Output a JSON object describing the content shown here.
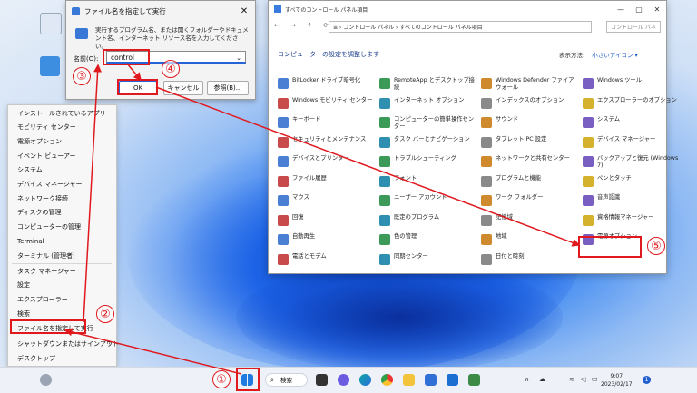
{
  "run_dialog": {
    "title": "ファイル名を指定して実行",
    "close": "✕",
    "description": "実行するプログラム名、または開くフォルダーやドキュメント名、インターネット リソース名を入力してください。",
    "label": "名前(O):",
    "value": "control",
    "ok": "OK",
    "cancel": "キャンセル",
    "browse": "参照(B)..."
  },
  "context_menu": {
    "items": [
      "インストールされているアプリ",
      "モビリティ センター",
      "電源オプション",
      "イベント ビューアー",
      "システム",
      "デバイス マネージャー",
      "ネットワーク接続",
      "ディスクの管理",
      "コンピューターの管理",
      "Terminal",
      "ターミナル (管理者)",
      "タスク マネージャー",
      "設定",
      "エクスプローラー",
      "検索",
      "ファイル名を指定して実行",
      "シャットダウンまたはサインアウト",
      "デスクトップ"
    ],
    "submenu_arrow": "›"
  },
  "control_panel": {
    "title": "すべてのコントロール パネル項目",
    "nav": "← → ↑ ⟳",
    "address": "≡ › コントロール パネル › すべてのコントロール パネル項目",
    "search_placeholder": "コントロール パネ",
    "heading": "コンピューターの設定を調整します",
    "view_label": "表示方法:",
    "view_value": "小さいアイコン ▾",
    "items": [
      [
        "BitLocker ドライブ暗号化",
        "RemoteApp とデスクトップ接続",
        "Windows Defender ファイアウォール",
        "Windows ツール"
      ],
      [
        "Windows モビリティ センター",
        "インターネット オプション",
        "インデックスのオプション",
        "エクスプローラーのオプション"
      ],
      [
        "キーボード",
        "コンピューターの簡単操作センター",
        "サウンド",
        "システム"
      ],
      [
        "セキュリティとメンテナンス",
        "タスク バーとナビゲーション",
        "タブレット PC 設定",
        "デバイス マネージャー"
      ],
      [
        "デバイスとプリンター",
        "トラブルシューティング",
        "ネットワークと共有センター",
        "バックアップと復元 (Windows 7)"
      ],
      [
        "ファイル履歴",
        "フォント",
        "プログラムと機能",
        "ペンとタッチ"
      ],
      [
        "マウス",
        "ユーザー アカウント",
        "ワーク フォルダー",
        "音声認識"
      ],
      [
        "回復",
        "既定のプログラム",
        "記憶域",
        "資格情報マネージャー"
      ],
      [
        "自動再生",
        "色の管理",
        "地域",
        "電源オプション"
      ],
      [
        "電話とモデム",
        "同期センター",
        "日付と時刻",
        ""
      ]
    ]
  },
  "taskbar": {
    "search": "検索",
    "time": "9:07",
    "date": "2023/02/17",
    "notifications": "1",
    "chevron": "∧"
  },
  "annotations": [
    "①",
    "②",
    "③",
    "④",
    "⑤"
  ],
  "colors": {
    "accent": "#2563d6",
    "annotation": "#e0191e"
  }
}
